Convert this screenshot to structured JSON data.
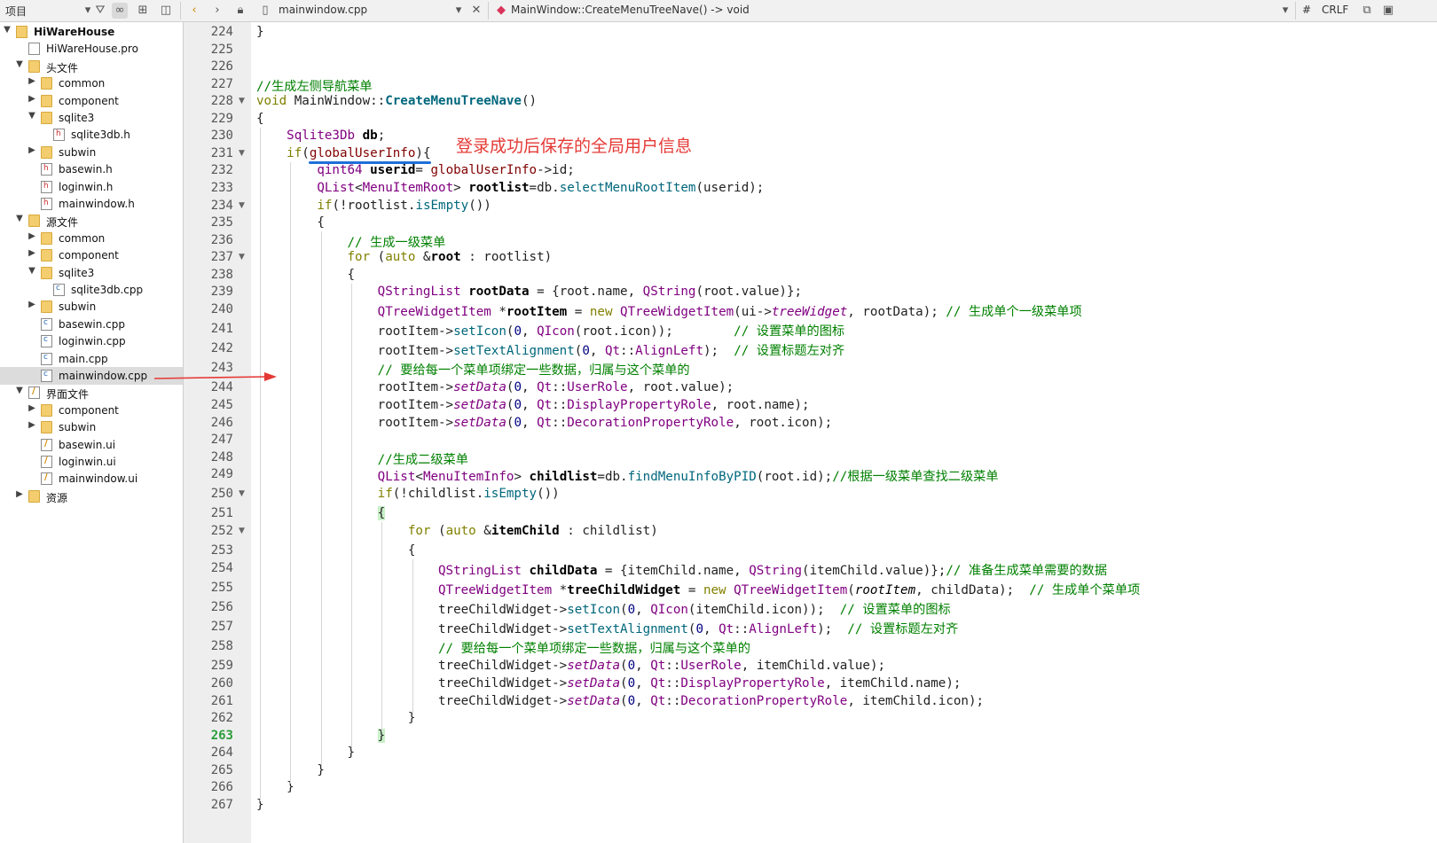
{
  "toolbar": {
    "project_label": "项目",
    "filename": "mainwindow.cpp",
    "function_sig": "MainWindow::CreateMenuTreeNave() -> void",
    "hash": "#",
    "line_ending": "CRLF"
  },
  "project_tree": [
    {
      "label": "HiWareHouse",
      "depth": 0,
      "arrow": "expanded",
      "icon": "proj",
      "bold": true
    },
    {
      "label": "HiWareHouse.pro",
      "depth": 1,
      "arrow": "none",
      "icon": "file"
    },
    {
      "label": "头文件",
      "depth": 1,
      "arrow": "expanded",
      "icon": "folder"
    },
    {
      "label": "common",
      "depth": 2,
      "arrow": "collapsed",
      "icon": "folder"
    },
    {
      "label": "component",
      "depth": 2,
      "arrow": "collapsed",
      "icon": "folder"
    },
    {
      "label": "sqlite3",
      "depth": 2,
      "arrow": "expanded",
      "icon": "folder"
    },
    {
      "label": "sqlite3db.h",
      "depth": 3,
      "arrow": "none",
      "icon": "hfile"
    },
    {
      "label": "subwin",
      "depth": 2,
      "arrow": "collapsed",
      "icon": "folder"
    },
    {
      "label": "basewin.h",
      "depth": 2,
      "arrow": "none",
      "icon": "hfile"
    },
    {
      "label": "loginwin.h",
      "depth": 2,
      "arrow": "none",
      "icon": "hfile"
    },
    {
      "label": "mainwindow.h",
      "depth": 2,
      "arrow": "none",
      "icon": "hfile"
    },
    {
      "label": "源文件",
      "depth": 1,
      "arrow": "expanded",
      "icon": "folder"
    },
    {
      "label": "common",
      "depth": 2,
      "arrow": "collapsed",
      "icon": "folder"
    },
    {
      "label": "component",
      "depth": 2,
      "arrow": "collapsed",
      "icon": "folder"
    },
    {
      "label": "sqlite3",
      "depth": 2,
      "arrow": "expanded",
      "icon": "folder"
    },
    {
      "label": "sqlite3db.cpp",
      "depth": 3,
      "arrow": "none",
      "icon": "cfile"
    },
    {
      "label": "subwin",
      "depth": 2,
      "arrow": "collapsed",
      "icon": "folder"
    },
    {
      "label": "basewin.cpp",
      "depth": 2,
      "arrow": "none",
      "icon": "cfile"
    },
    {
      "label": "loginwin.cpp",
      "depth": 2,
      "arrow": "none",
      "icon": "cfile"
    },
    {
      "label": "main.cpp",
      "depth": 2,
      "arrow": "none",
      "icon": "cfile"
    },
    {
      "label": "mainwindow.cpp",
      "depth": 2,
      "arrow": "none",
      "icon": "cfile",
      "selected": true
    },
    {
      "label": "界面文件",
      "depth": 1,
      "arrow": "expanded",
      "icon": "ufile"
    },
    {
      "label": "component",
      "depth": 2,
      "arrow": "collapsed",
      "icon": "folder"
    },
    {
      "label": "subwin",
      "depth": 2,
      "arrow": "collapsed",
      "icon": "folder"
    },
    {
      "label": "basewin.ui",
      "depth": 2,
      "arrow": "none",
      "icon": "ufile"
    },
    {
      "label": "loginwin.ui",
      "depth": 2,
      "arrow": "none",
      "icon": "ufile"
    },
    {
      "label": "mainwindow.ui",
      "depth": 2,
      "arrow": "none",
      "icon": "ufile"
    },
    {
      "label": "资源",
      "depth": 1,
      "arrow": "collapsed",
      "icon": "folder"
    }
  ],
  "editor": {
    "current_line": 263,
    "annotation": "登录成功后保存的全局用户信息",
    "lines": [
      {
        "n": 224,
        "fold": false,
        "t": "}"
      },
      {
        "n": 225,
        "fold": false,
        "t": ""
      },
      {
        "n": 226,
        "fold": false,
        "t": ""
      },
      {
        "n": 227,
        "fold": false,
        "t": "//生成左侧导航菜单"
      },
      {
        "n": 228,
        "fold": true,
        "t": "void MainWindow::CreateMenuTreeNave()"
      },
      {
        "n": 229,
        "fold": false,
        "t": "{"
      },
      {
        "n": 230,
        "fold": false,
        "t": "    Sqlite3Db db;"
      },
      {
        "n": 231,
        "fold": true,
        "t": "    if(globalUserInfo){"
      },
      {
        "n": 232,
        "fold": false,
        "t": "        qint64 userid= globalUserInfo->id;"
      },
      {
        "n": 233,
        "fold": false,
        "t": "        QList<MenuItemRoot> rootlist=db.selectMenuRootItem(userid);"
      },
      {
        "n": 234,
        "fold": true,
        "t": "        if(!rootlist.isEmpty())"
      },
      {
        "n": 235,
        "fold": false,
        "t": "        {"
      },
      {
        "n": 236,
        "fold": false,
        "t": "            // 生成一级菜单"
      },
      {
        "n": 237,
        "fold": true,
        "t": "            for (auto &root : rootlist)"
      },
      {
        "n": 238,
        "fold": false,
        "t": "            {"
      },
      {
        "n": 239,
        "fold": false,
        "t": "                QStringList rootData = {root.name, QString(root.value)};"
      },
      {
        "n": 240,
        "fold": false,
        "t": "                QTreeWidgetItem *rootItem = new QTreeWidgetItem(ui->treeWidget, rootData); // 生成单个一级菜单项"
      },
      {
        "n": 241,
        "fold": false,
        "t": "                rootItem->setIcon(0, QIcon(root.icon));        // 设置菜单的图标"
      },
      {
        "n": 242,
        "fold": false,
        "t": "                rootItem->setTextAlignment(0, Qt::AlignLeft);  // 设置标题左对齐"
      },
      {
        "n": 243,
        "fold": false,
        "t": "                // 要给每一个菜单项绑定一些数据，归属与这个菜单的"
      },
      {
        "n": 244,
        "fold": false,
        "t": "                rootItem->setData(0, Qt::UserRole, root.value);"
      },
      {
        "n": 245,
        "fold": false,
        "t": "                rootItem->setData(0, Qt::DisplayPropertyRole, root.name);"
      },
      {
        "n": 246,
        "fold": false,
        "t": "                rootItem->setData(0, Qt::DecorationPropertyRole, root.icon);"
      },
      {
        "n": 247,
        "fold": false,
        "t": ""
      },
      {
        "n": 248,
        "fold": false,
        "t": "                //生成二级菜单"
      },
      {
        "n": 249,
        "fold": false,
        "t": "                QList<MenuItemInfo> childlist=db.findMenuInfoByPID(root.id);//根据一级菜单查找二级菜单"
      },
      {
        "n": 250,
        "fold": true,
        "t": "                if(!childlist.isEmpty())"
      },
      {
        "n": 251,
        "fold": false,
        "t": "                {"
      },
      {
        "n": 252,
        "fold": true,
        "t": "                    for (auto &itemChild : childlist)"
      },
      {
        "n": 253,
        "fold": false,
        "t": "                    {"
      },
      {
        "n": 254,
        "fold": false,
        "t": "                        QStringList childData = {itemChild.name, QString(itemChild.value)};// 准备生成菜单需要的数据"
      },
      {
        "n": 255,
        "fold": false,
        "t": "                        QTreeWidgetItem *treeChildWidget = new QTreeWidgetItem(rootItem, childData);  // 生成单个菜单项"
      },
      {
        "n": 256,
        "fold": false,
        "t": "                        treeChildWidget->setIcon(0, QIcon(itemChild.icon));  // 设置菜单的图标"
      },
      {
        "n": 257,
        "fold": false,
        "t": "                        treeChildWidget->setTextAlignment(0, Qt::AlignLeft);  // 设置标题左对齐"
      },
      {
        "n": 258,
        "fold": false,
        "t": "                        // 要给每一个菜单项绑定一些数据，归属与这个菜单的"
      },
      {
        "n": 259,
        "fold": false,
        "t": "                        treeChildWidget->setData(0, Qt::UserRole, itemChild.value);"
      },
      {
        "n": 260,
        "fold": false,
        "t": "                        treeChildWidget->setData(0, Qt::DisplayPropertyRole, itemChild.name);"
      },
      {
        "n": 261,
        "fold": false,
        "t": "                        treeChildWidget->setData(0, Qt::DecorationPropertyRole, itemChild.icon);"
      },
      {
        "n": 262,
        "fold": false,
        "t": "                    }"
      },
      {
        "n": 263,
        "fold": false,
        "t": "                }"
      },
      {
        "n": 264,
        "fold": false,
        "t": "            }"
      },
      {
        "n": 265,
        "fold": false,
        "t": "        }"
      },
      {
        "n": 266,
        "fold": false,
        "t": "    }"
      },
      {
        "n": 267,
        "fold": false,
        "t": "}"
      }
    ]
  }
}
